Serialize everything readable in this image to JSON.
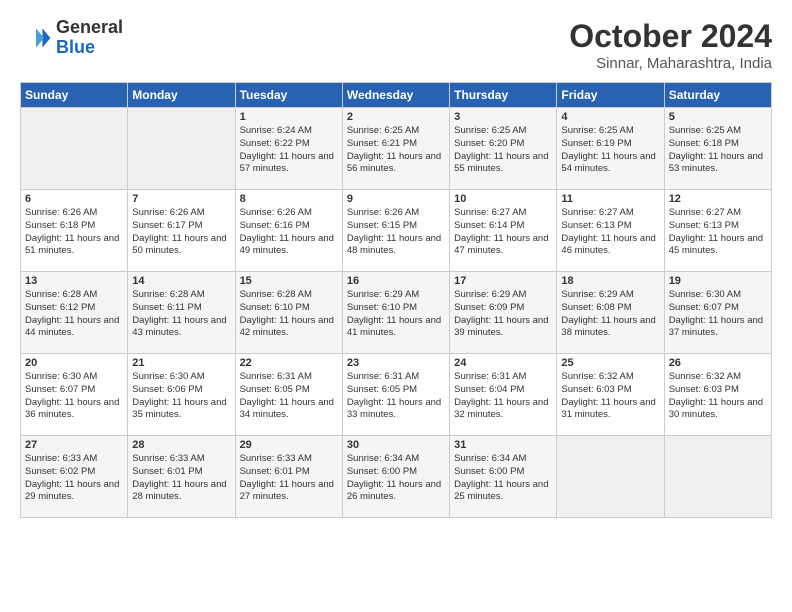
{
  "header": {
    "logo_general": "General",
    "logo_blue": "Blue",
    "title": "October 2024",
    "subtitle": "Sinnar, Maharashtra, India"
  },
  "days_of_week": [
    "Sunday",
    "Monday",
    "Tuesday",
    "Wednesday",
    "Thursday",
    "Friday",
    "Saturday"
  ],
  "weeks": [
    [
      {
        "day": "",
        "info": ""
      },
      {
        "day": "",
        "info": ""
      },
      {
        "day": "1",
        "info": "Sunrise: 6:24 AM\nSunset: 6:22 PM\nDaylight: 11 hours and 57 minutes."
      },
      {
        "day": "2",
        "info": "Sunrise: 6:25 AM\nSunset: 6:21 PM\nDaylight: 11 hours and 56 minutes."
      },
      {
        "day": "3",
        "info": "Sunrise: 6:25 AM\nSunset: 6:20 PM\nDaylight: 11 hours and 55 minutes."
      },
      {
        "day": "4",
        "info": "Sunrise: 6:25 AM\nSunset: 6:19 PM\nDaylight: 11 hours and 54 minutes."
      },
      {
        "day": "5",
        "info": "Sunrise: 6:25 AM\nSunset: 6:18 PM\nDaylight: 11 hours and 53 minutes."
      }
    ],
    [
      {
        "day": "6",
        "info": "Sunrise: 6:26 AM\nSunset: 6:18 PM\nDaylight: 11 hours and 51 minutes."
      },
      {
        "day": "7",
        "info": "Sunrise: 6:26 AM\nSunset: 6:17 PM\nDaylight: 11 hours and 50 minutes."
      },
      {
        "day": "8",
        "info": "Sunrise: 6:26 AM\nSunset: 6:16 PM\nDaylight: 11 hours and 49 minutes."
      },
      {
        "day": "9",
        "info": "Sunrise: 6:26 AM\nSunset: 6:15 PM\nDaylight: 11 hours and 48 minutes."
      },
      {
        "day": "10",
        "info": "Sunrise: 6:27 AM\nSunset: 6:14 PM\nDaylight: 11 hours and 47 minutes."
      },
      {
        "day": "11",
        "info": "Sunrise: 6:27 AM\nSunset: 6:13 PM\nDaylight: 11 hours and 46 minutes."
      },
      {
        "day": "12",
        "info": "Sunrise: 6:27 AM\nSunset: 6:13 PM\nDaylight: 11 hours and 45 minutes."
      }
    ],
    [
      {
        "day": "13",
        "info": "Sunrise: 6:28 AM\nSunset: 6:12 PM\nDaylight: 11 hours and 44 minutes."
      },
      {
        "day": "14",
        "info": "Sunrise: 6:28 AM\nSunset: 6:11 PM\nDaylight: 11 hours and 43 minutes."
      },
      {
        "day": "15",
        "info": "Sunrise: 6:28 AM\nSunset: 6:10 PM\nDaylight: 11 hours and 42 minutes."
      },
      {
        "day": "16",
        "info": "Sunrise: 6:29 AM\nSunset: 6:10 PM\nDaylight: 11 hours and 41 minutes."
      },
      {
        "day": "17",
        "info": "Sunrise: 6:29 AM\nSunset: 6:09 PM\nDaylight: 11 hours and 39 minutes."
      },
      {
        "day": "18",
        "info": "Sunrise: 6:29 AM\nSunset: 6:08 PM\nDaylight: 11 hours and 38 minutes."
      },
      {
        "day": "19",
        "info": "Sunrise: 6:30 AM\nSunset: 6:07 PM\nDaylight: 11 hours and 37 minutes."
      }
    ],
    [
      {
        "day": "20",
        "info": "Sunrise: 6:30 AM\nSunset: 6:07 PM\nDaylight: 11 hours and 36 minutes."
      },
      {
        "day": "21",
        "info": "Sunrise: 6:30 AM\nSunset: 6:06 PM\nDaylight: 11 hours and 35 minutes."
      },
      {
        "day": "22",
        "info": "Sunrise: 6:31 AM\nSunset: 6:05 PM\nDaylight: 11 hours and 34 minutes."
      },
      {
        "day": "23",
        "info": "Sunrise: 6:31 AM\nSunset: 6:05 PM\nDaylight: 11 hours and 33 minutes."
      },
      {
        "day": "24",
        "info": "Sunrise: 6:31 AM\nSunset: 6:04 PM\nDaylight: 11 hours and 32 minutes."
      },
      {
        "day": "25",
        "info": "Sunrise: 6:32 AM\nSunset: 6:03 PM\nDaylight: 11 hours and 31 minutes."
      },
      {
        "day": "26",
        "info": "Sunrise: 6:32 AM\nSunset: 6:03 PM\nDaylight: 11 hours and 30 minutes."
      }
    ],
    [
      {
        "day": "27",
        "info": "Sunrise: 6:33 AM\nSunset: 6:02 PM\nDaylight: 11 hours and 29 minutes."
      },
      {
        "day": "28",
        "info": "Sunrise: 6:33 AM\nSunset: 6:01 PM\nDaylight: 11 hours and 28 minutes."
      },
      {
        "day": "29",
        "info": "Sunrise: 6:33 AM\nSunset: 6:01 PM\nDaylight: 11 hours and 27 minutes."
      },
      {
        "day": "30",
        "info": "Sunrise: 6:34 AM\nSunset: 6:00 PM\nDaylight: 11 hours and 26 minutes."
      },
      {
        "day": "31",
        "info": "Sunrise: 6:34 AM\nSunset: 6:00 PM\nDaylight: 11 hours and 25 minutes."
      },
      {
        "day": "",
        "info": ""
      },
      {
        "day": "",
        "info": ""
      }
    ]
  ]
}
